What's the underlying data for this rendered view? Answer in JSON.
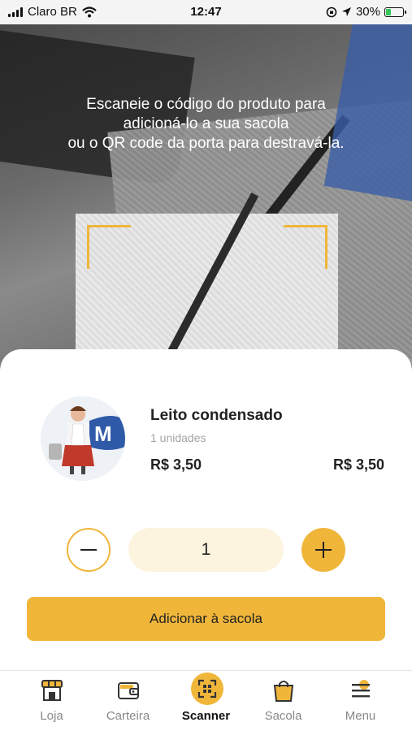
{
  "status_bar": {
    "carrier": "Claro BR",
    "time": "12:47",
    "battery": "30%",
    "battery_level": 0.3
  },
  "scanner": {
    "instructions": "Escaneie o código do produto para\nadicioná-lo a sua sacola\nou o QR code da porta para destravá-la."
  },
  "product": {
    "name": "Leito condensado",
    "units": "1 unidades",
    "price": "R$ 3,50",
    "total": "R$ 3,50",
    "image_logo_text": "M"
  },
  "quantity": {
    "value": "1"
  },
  "add_button": {
    "label": "Adicionar à sacola"
  },
  "colors": {
    "accent": "#f0b63a",
    "accent_light": "#fdf4df"
  },
  "tabs": [
    {
      "label": "Loja",
      "icon": "store-icon"
    },
    {
      "label": "Carteira",
      "icon": "wallet-icon"
    },
    {
      "label": "Scanner",
      "icon": "scanner-icon",
      "active": true
    },
    {
      "label": "Sacola",
      "icon": "bag-icon"
    },
    {
      "label": "Menu",
      "icon": "menu-icon"
    }
  ]
}
